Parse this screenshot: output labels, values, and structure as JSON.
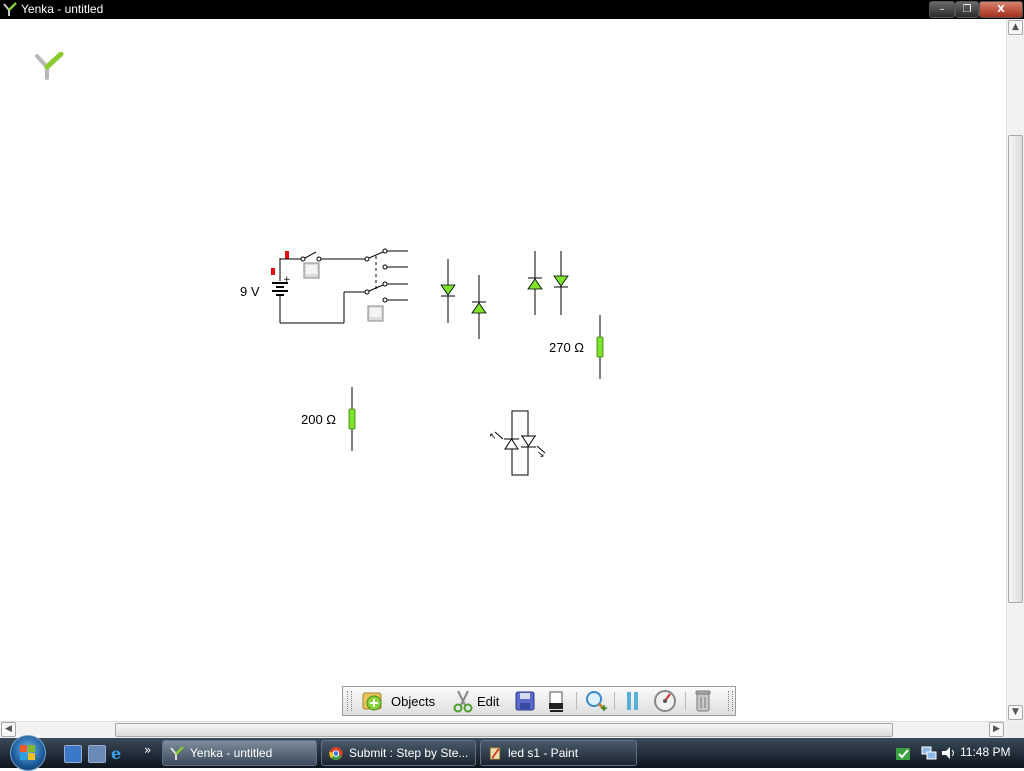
{
  "window": {
    "title": "Yenka - untitled",
    "minimize_label": "–",
    "restore_label": "❐",
    "close_label": "X"
  },
  "circuit": {
    "battery_label": "9 V",
    "resistor1_label": "270 Ω",
    "resistor2_label": "200 Ω"
  },
  "toolbar": {
    "objects_label": "Objects",
    "edit_label": "Edit"
  },
  "scrollbars": {
    "up_arrow": "▲",
    "down_arrow": "▼",
    "left_arrow": "◀",
    "right_arrow": "▶"
  },
  "taskbar": {
    "more_label": "»",
    "tasks": [
      {
        "label": "Yenka - untitled"
      },
      {
        "label": "Submit : Step by Ste..."
      },
      {
        "label": "led s1 - Paint"
      }
    ],
    "clock": "11:48 PM"
  },
  "colors": {
    "component_green": "#7ee22a",
    "wire": "#000000",
    "marker_red": "#e01010"
  }
}
